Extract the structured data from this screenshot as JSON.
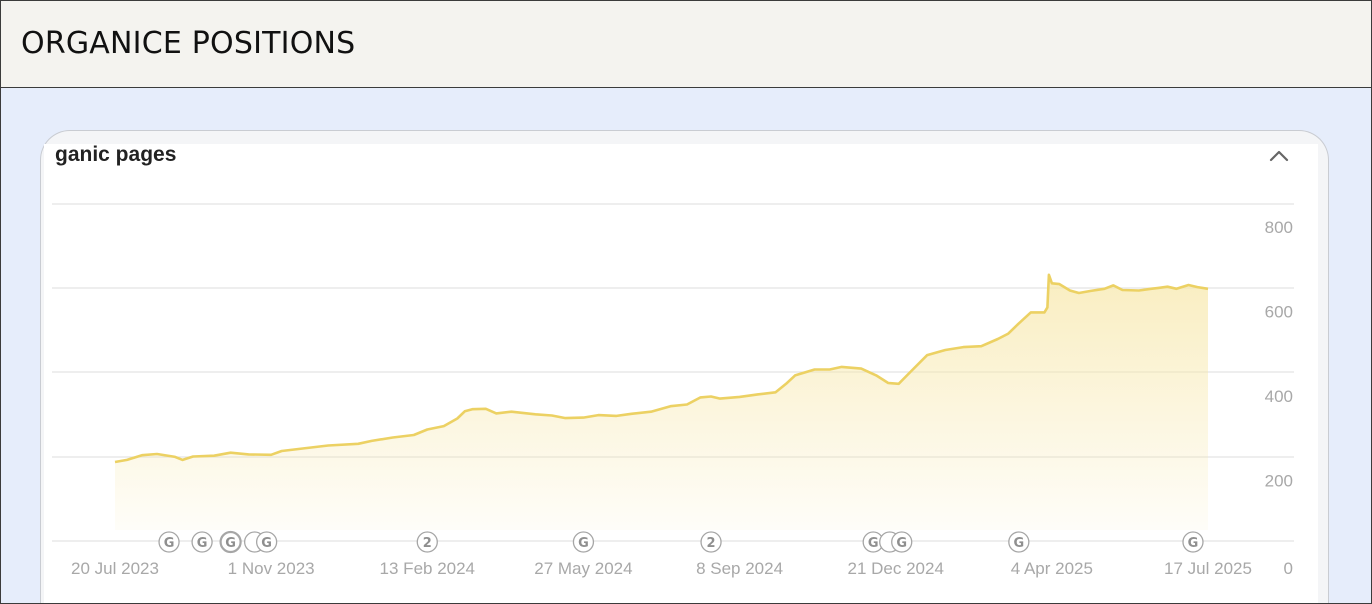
{
  "header": {
    "title": "ORGANICE POSITIONS"
  },
  "card": {
    "title": "ganic pages",
    "collapse_icon": "chevron-up-icon"
  },
  "colors": {
    "line": "#ecd163",
    "fill_top": "#f7e8ac",
    "grid": "#e3e3e3",
    "tick": "#a8a8a8",
    "marker": "#a6a6a6"
  },
  "chart_data": {
    "type": "area",
    "title": "ganic pages",
    "x_tick_labels": [
      "20 Jul 2023",
      "1 Nov 2023",
      "13 Feb 2024",
      "27 May 2024",
      "8 Sep 2024",
      "21 Dec 2024",
      "4 Apr 2025",
      "17 Jul 2025"
    ],
    "x_tick_dates": [
      "2023-07-20",
      "2023-11-01",
      "2024-02-13",
      "2024-05-27",
      "2024-09-08",
      "2024-12-21",
      "2025-04-04",
      "2025-07-17"
    ],
    "y_tick_labels": [
      "0",
      "200",
      "400",
      "600",
      "800"
    ],
    "y_ticks": [
      0,
      200,
      400,
      600,
      800
    ],
    "ylim": [
      0,
      800
    ],
    "xlim": [
      "2023-07-20",
      "2025-07-17"
    ],
    "y_axis_side": "right",
    "grid": true,
    "series": [
      {
        "points": [
          [
            "2023-07-20",
            187
          ],
          [
            "2023-07-28",
            192
          ],
          [
            "2023-08-07",
            203
          ],
          [
            "2023-08-17",
            206
          ],
          [
            "2023-08-29",
            199
          ],
          [
            "2023-09-03",
            192
          ],
          [
            "2023-09-10",
            200
          ],
          [
            "2023-09-24",
            202
          ],
          [
            "2023-10-05",
            209
          ],
          [
            "2023-10-17",
            205
          ],
          [
            "2023-11-01",
            204
          ],
          [
            "2023-11-08",
            213
          ],
          [
            "2023-11-22",
            219
          ],
          [
            "2023-12-09",
            226
          ],
          [
            "2023-12-29",
            230
          ],
          [
            "2024-01-07",
            237
          ],
          [
            "2024-01-21",
            245
          ],
          [
            "2024-02-04",
            251
          ],
          [
            "2024-02-13",
            264
          ],
          [
            "2024-02-24",
            272
          ],
          [
            "2024-03-04",
            290
          ],
          [
            "2024-03-09",
            307
          ],
          [
            "2024-03-14",
            312
          ],
          [
            "2024-03-23",
            313
          ],
          [
            "2024-03-30",
            302
          ],
          [
            "2024-04-09",
            306
          ],
          [
            "2024-04-25",
            300
          ],
          [
            "2024-05-06",
            297
          ],
          [
            "2024-05-15",
            291
          ],
          [
            "2024-05-27",
            292
          ],
          [
            "2024-06-06",
            298
          ],
          [
            "2024-06-18",
            296
          ],
          [
            "2024-06-28",
            301
          ],
          [
            "2024-07-11",
            306
          ],
          [
            "2024-07-24",
            319
          ],
          [
            "2024-08-04",
            323
          ],
          [
            "2024-08-13",
            340
          ],
          [
            "2024-08-20",
            342
          ],
          [
            "2024-08-26",
            337
          ],
          [
            "2024-09-08",
            341
          ],
          [
            "2024-09-20",
            347
          ],
          [
            "2024-10-02",
            352
          ],
          [
            "2024-10-09",
            372
          ],
          [
            "2024-10-15",
            392
          ],
          [
            "2024-10-28",
            406
          ],
          [
            "2024-11-07",
            406
          ],
          [
            "2024-11-15",
            412
          ],
          [
            "2024-11-28",
            408
          ],
          [
            "2024-12-08",
            392
          ],
          [
            "2024-12-16",
            374
          ],
          [
            "2024-12-23",
            372
          ],
          [
            "2024-12-31",
            401
          ],
          [
            "2025-01-11",
            440
          ],
          [
            "2025-01-23",
            452
          ],
          [
            "2025-02-04",
            459
          ],
          [
            "2025-02-16",
            461
          ],
          [
            "2025-02-27",
            478
          ],
          [
            "2025-03-06",
            491
          ],
          [
            "2025-03-13",
            515
          ],
          [
            "2025-03-21",
            541
          ],
          [
            "2025-03-30",
            541
          ],
          [
            "2025-04-01",
            553
          ],
          [
            "2025-04-02",
            630
          ],
          [
            "2025-04-04",
            610
          ],
          [
            "2025-04-09",
            608
          ],
          [
            "2025-04-16",
            593
          ],
          [
            "2025-04-22",
            587
          ],
          [
            "2025-04-30",
            592
          ],
          [
            "2025-05-09",
            597
          ],
          [
            "2025-05-15",
            605
          ],
          [
            "2025-05-21",
            594
          ],
          [
            "2025-06-01",
            593
          ],
          [
            "2025-06-09",
            597
          ],
          [
            "2025-06-14",
            599
          ],
          [
            "2025-06-20",
            602
          ],
          [
            "2025-06-26",
            597
          ],
          [
            "2025-07-04",
            606
          ],
          [
            "2025-07-10",
            601
          ],
          [
            "2025-07-17",
            597
          ]
        ]
      }
    ],
    "annotations": [
      {
        "label": "G",
        "date": "2023-08-25"
      },
      {
        "label": "G",
        "date": "2023-09-16"
      },
      {
        "label": "G",
        "date": "2023-10-05",
        "bold": true
      },
      {
        "label": "G",
        "date": "2023-10-29",
        "stacked": true
      },
      {
        "label": "2",
        "date": "2024-02-13"
      },
      {
        "label": "G",
        "date": "2024-05-27"
      },
      {
        "label": "2",
        "date": "2024-08-20"
      },
      {
        "label": "G",
        "date": "2024-12-06"
      },
      {
        "label": "G",
        "date": "2024-12-25",
        "stacked": true
      },
      {
        "label": "G",
        "date": "2025-03-13"
      },
      {
        "label": "G",
        "date": "2025-07-07"
      }
    ]
  }
}
